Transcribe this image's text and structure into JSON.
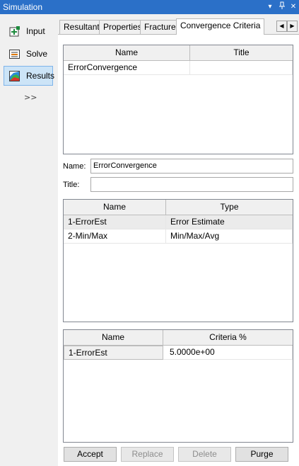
{
  "window": {
    "title": "Simulation",
    "controls": {
      "dropdown": "▾",
      "pin": "ᵖ",
      "close": "✕"
    }
  },
  "sidebar": {
    "items": [
      {
        "label": "Input",
        "icon": "input-icon",
        "active": false
      },
      {
        "label": "Solve",
        "icon": "solve-icon",
        "active": false
      },
      {
        "label": "Results",
        "icon": "results-icon",
        "active": true
      }
    ],
    "more": ">>"
  },
  "tabs": [
    {
      "label": "Resultant",
      "active": false
    },
    {
      "label": "Properties",
      "active": false
    },
    {
      "label": "Fracture",
      "active": false
    },
    {
      "label": "Convergence Criteria",
      "active": true
    }
  ],
  "tab_scroll": {
    "left": "◀",
    "right": "▶"
  },
  "criteria_table": {
    "headers": [
      "Name",
      "Title"
    ],
    "rows": [
      [
        "ErrorConvergence",
        ""
      ]
    ]
  },
  "form": {
    "name_label": "Name:",
    "name_value": "ErrorConvergence",
    "title_label": "Title:",
    "title_value": ""
  },
  "type_table": {
    "headers": [
      "Name",
      "Type"
    ],
    "rows": [
      [
        "1-ErrorEst",
        "Error Estimate"
      ],
      [
        "2-Min/Max",
        "Min/Max/Avg"
      ]
    ]
  },
  "criteria_pct_table": {
    "headers": [
      "Name",
      "Criteria %"
    ],
    "rows": [
      [
        "1-ErrorEst",
        "5.0000e+00"
      ]
    ]
  },
  "buttons": {
    "accept": "Accept",
    "replace": "Replace",
    "delete": "Delete",
    "purge": "Purge"
  }
}
